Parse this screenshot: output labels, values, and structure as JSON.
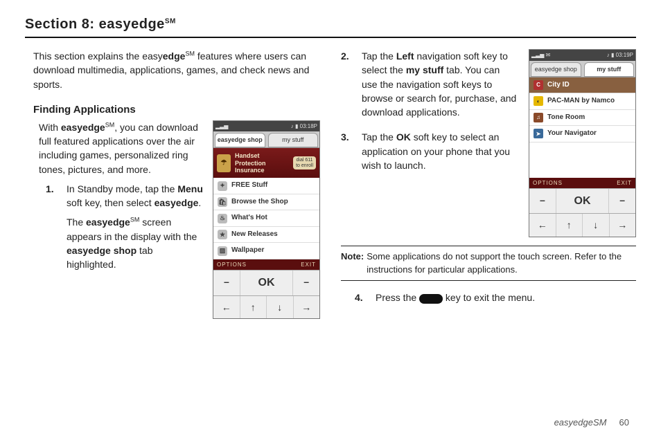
{
  "section": {
    "prefix": "Section 8: easy",
    "bold": "edge",
    "sup": "SM"
  },
  "intro": {
    "a": "This section explains the easy",
    "b": "edge",
    "sup": "SM",
    "c": " features where users can download multimedia, applications, games, and check news and sports."
  },
  "subhead": "Finding Applications",
  "with": {
    "a": "With ",
    "b": "easyedge",
    "sup": "SM",
    "c": ", you can download full featured applications over the air including games, personalized ring tones, pictures, and more."
  },
  "step1": {
    "num": "1.",
    "a": "In Standby mode, tap the ",
    "b": "Menu",
    "c": " soft key, then select ",
    "d": "easyedge",
    "e": ".",
    "l2a": "The ",
    "l2b": "easyedge",
    "l2sup": "SM",
    "l2c": " screen appears in the display with the ",
    "l2d": "easyedge shop",
    "l2e": " tab highlighted."
  },
  "step2": {
    "num": "2.",
    "a": "Tap the ",
    "b": "Left",
    "c": " navigation soft key to select the ",
    "d": "my stuff",
    "e": " tab. You can use the navigation soft keys to browse or search for, purchase, and download applications."
  },
  "step3": {
    "num": "3.",
    "a": "Tap the ",
    "b": "OK",
    "c": " soft key to select an application on your phone that you wish to launch."
  },
  "note": {
    "label": "Note:",
    "text": "Some applications do not support the touch screen. Refer to the instructions for particular applications."
  },
  "step4": {
    "num": "4.",
    "a": "Press the ",
    "b": " key to exit the menu."
  },
  "phone1": {
    "time": "03:18P",
    "tab_shop": "easyedge shop",
    "tab_mystuff": "my stuff",
    "banner_title": "Handset Protection Insurance",
    "banner_btn1": "dial 611",
    "banner_btn2": "to enroll",
    "items": {
      "i0": "FREE Stuff",
      "i1": "Browse the Shop",
      "i2": "What's Hot",
      "i3": "New Releases",
      "i4": "Wallpaper"
    },
    "soft_l": "OPTIONS",
    "soft_r": "EXIT",
    "ok": "OK"
  },
  "phone2": {
    "time": "03:19P",
    "tab_shop": "easyedge shop",
    "tab_mystuff": "my stuff",
    "items": {
      "i0": "City ID",
      "i1": "PAC-MAN by Namco",
      "i2": "Tone Room",
      "i3": "Your Navigator"
    },
    "soft_l": "OPTIONS",
    "soft_r": "EXIT",
    "ok": "OK"
  },
  "footer": {
    "label": "easyedgeSM",
    "page": "60"
  },
  "glyph": {
    "minus": "–",
    "left": "←",
    "up": "↑",
    "down": "↓",
    "right": "→",
    "music": "♪",
    "signal": "▯"
  }
}
